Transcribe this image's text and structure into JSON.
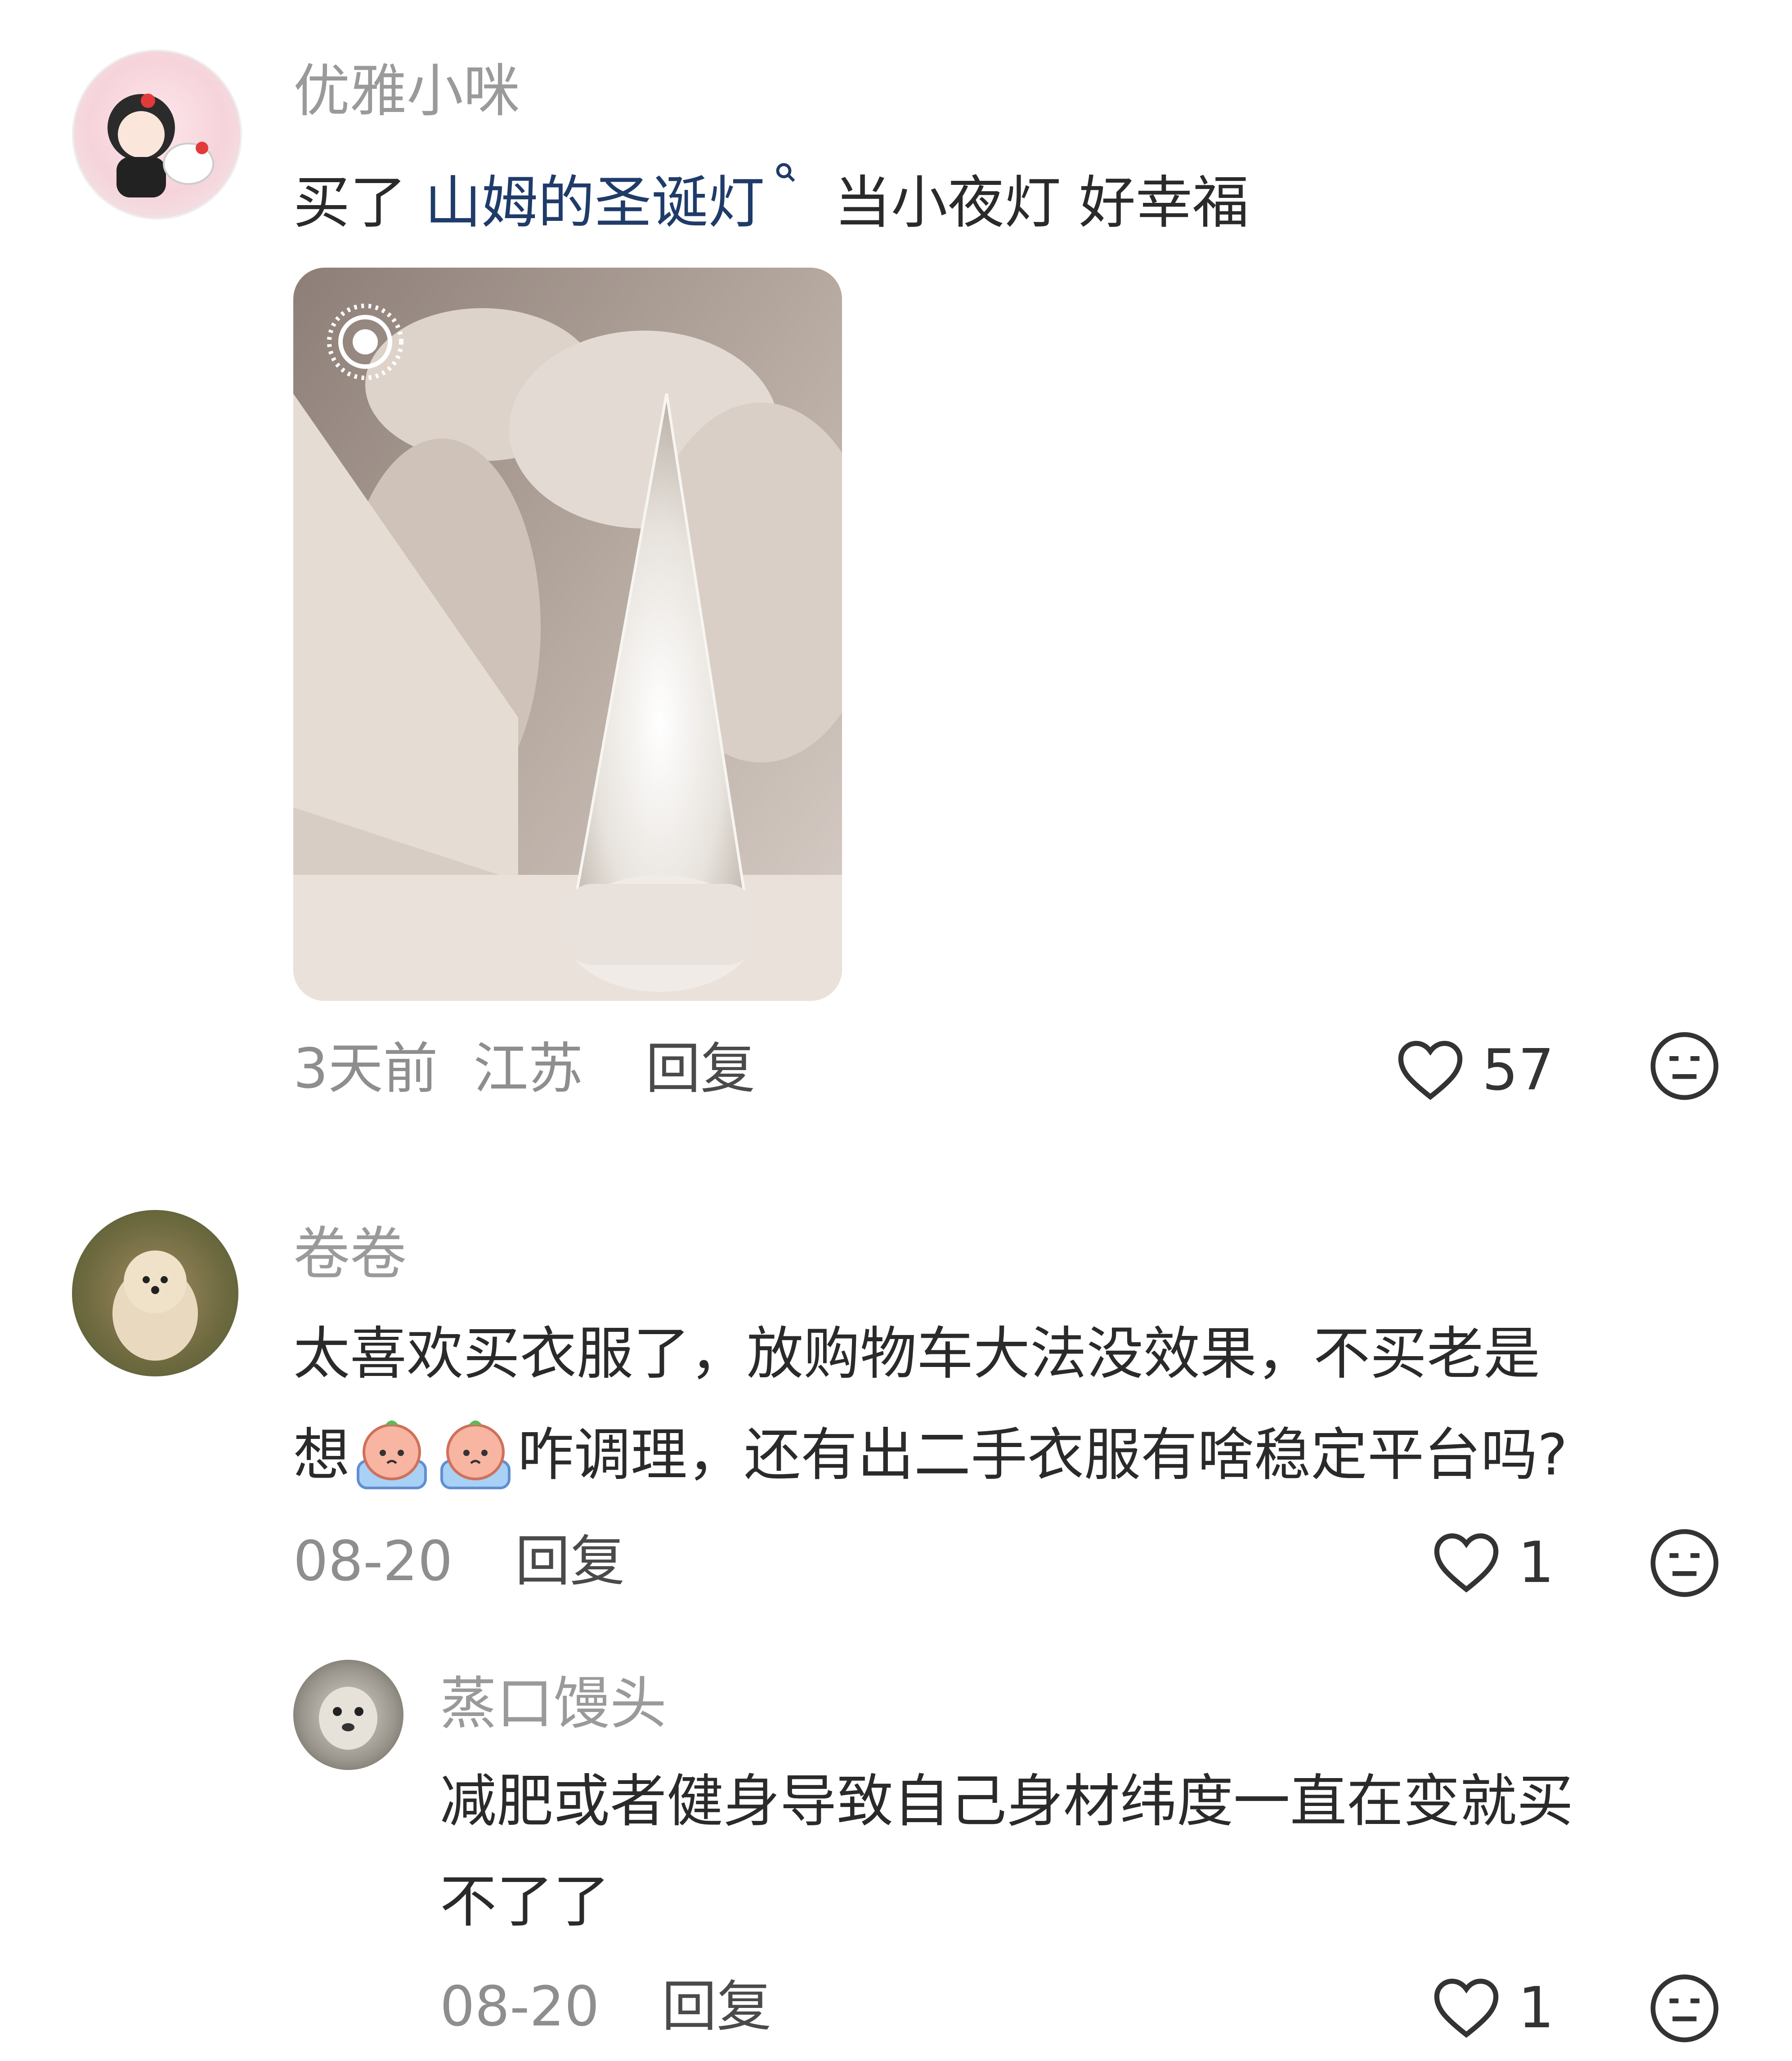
{
  "comments": [
    {
      "author": "优雅小咪",
      "text_prefix": "买了 ",
      "topic": "山姆的圣诞灯",
      "topic_icon": "search-icon",
      "text_suffix": "当小夜灯 好幸福",
      "has_image": true,
      "time": "3天前",
      "location": "江苏",
      "reply_label": "回复",
      "likes": "57"
    },
    {
      "author": "卷卷",
      "line1": "太喜欢买衣服了，放购物车大法没效果，不买老是",
      "line2_prefix": "想",
      "emoji": "crying-face-emoji",
      "line2_suffix": "咋调理，还有出二手衣服有啥稳定平台吗?",
      "time": "08-20",
      "reply_label": "回复",
      "likes": "1"
    },
    {
      "author": "蒸口馒头",
      "line1": "减肥或者健身导致自己身材纬度一直在变就买",
      "line2": "不了了",
      "time": "08-20",
      "reply_label": "回复",
      "likes": "1"
    }
  ],
  "colors": {
    "author": "#9a9a9a",
    "topic_link": "#1f3b69",
    "meta": "#8e8e8e"
  }
}
